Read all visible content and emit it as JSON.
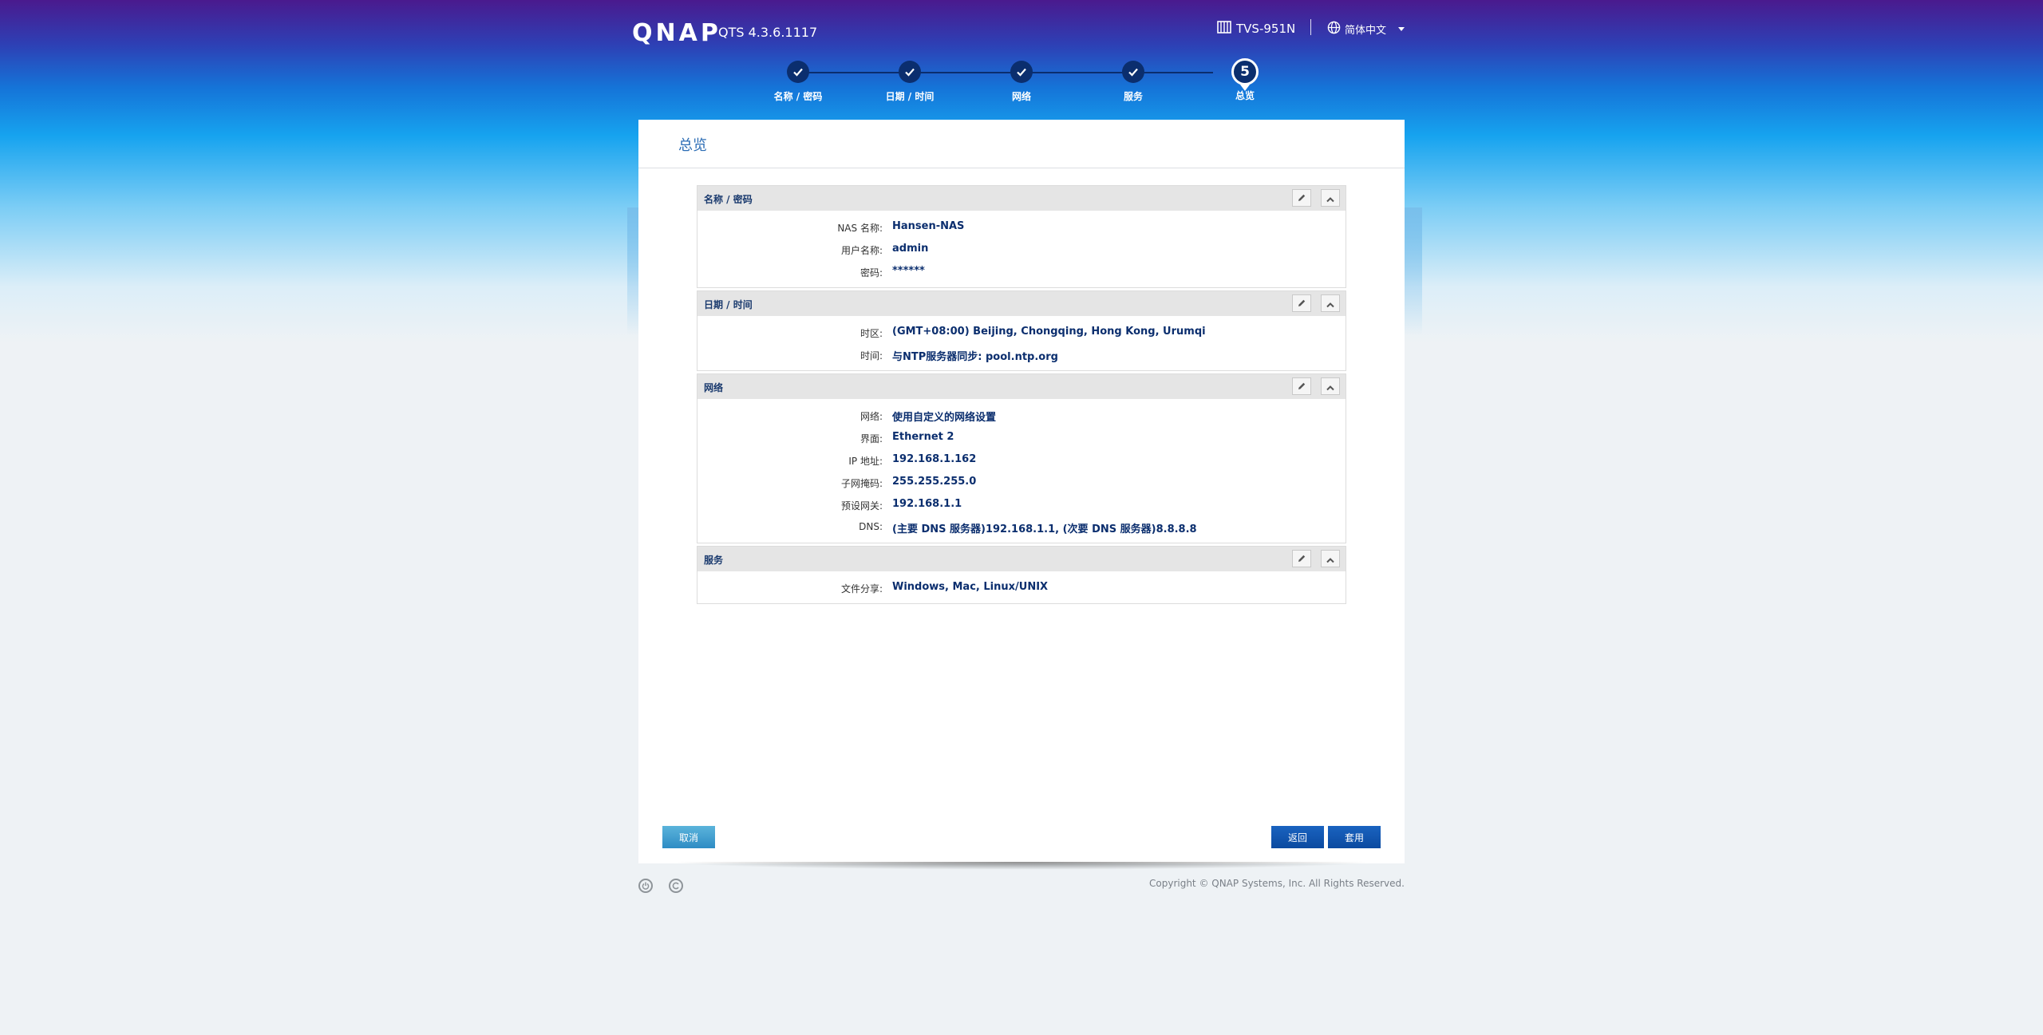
{
  "header": {
    "logo": "QNAP",
    "version": "QTS 4.3.6.1117",
    "device": "TVS-951N",
    "language": "简体中文"
  },
  "steps": [
    {
      "label": "名称 / 密码",
      "state": "done"
    },
    {
      "label": "日期 / 时间",
      "state": "done"
    },
    {
      "label": "网络",
      "state": "done"
    },
    {
      "label": "服务",
      "state": "done"
    },
    {
      "label": "总览",
      "state": "active",
      "number": "5"
    }
  ],
  "panel": {
    "title": "总览",
    "sections": [
      {
        "title": "名称 / 密码",
        "rows": [
          {
            "label": "NAS 名称:",
            "value": "Hansen-NAS"
          },
          {
            "label": "用户名称:",
            "value": "admin"
          },
          {
            "label": "密码:",
            "value": "******"
          }
        ]
      },
      {
        "title": "日期 / 时间",
        "rows": [
          {
            "label": "时区:",
            "value": "(GMT+08:00) Beijing, Chongqing, Hong Kong, Urumqi"
          },
          {
            "label": "时间:",
            "value": "与NTP服务器同步: pool.ntp.org"
          }
        ]
      },
      {
        "title": "网络",
        "rows": [
          {
            "label": "网络:",
            "value": "使用自定义的网络设置"
          },
          {
            "label": "界面:",
            "value": "Ethernet 2"
          },
          {
            "label": "IP 地址:",
            "value": "192.168.1.162"
          },
          {
            "label": "子网掩码:",
            "value": "255.255.255.0"
          },
          {
            "label": "预设网关:",
            "value": "192.168.1.1"
          },
          {
            "label": "DNS:",
            "value": "(主要 DNS 服务器)192.168.1.1, (次要 DNS 服务器)8.8.8.8"
          }
        ]
      },
      {
        "title": "服务",
        "rows": [
          {
            "label": "文件分享:",
            "value": "Windows, Mac, Linux/UNIX"
          }
        ]
      }
    ]
  },
  "buttons": {
    "cancel": "取消",
    "back": "返回",
    "apply": "套用"
  },
  "footer": {
    "copyright": "Copyright © QNAP Systems, Inc. All Rights Reserved."
  },
  "icons": {
    "edit": "pencil-icon",
    "collapse": "chevron-up-icon",
    "power": "power-icon",
    "refresh": "c-refresh-icon"
  },
  "colors": {
    "accent_dark": "#0b2e6e",
    "panel_title": "#2c6db5",
    "button_primary": "#0b4aa0",
    "button_cancel": "#2e8cc4"
  }
}
